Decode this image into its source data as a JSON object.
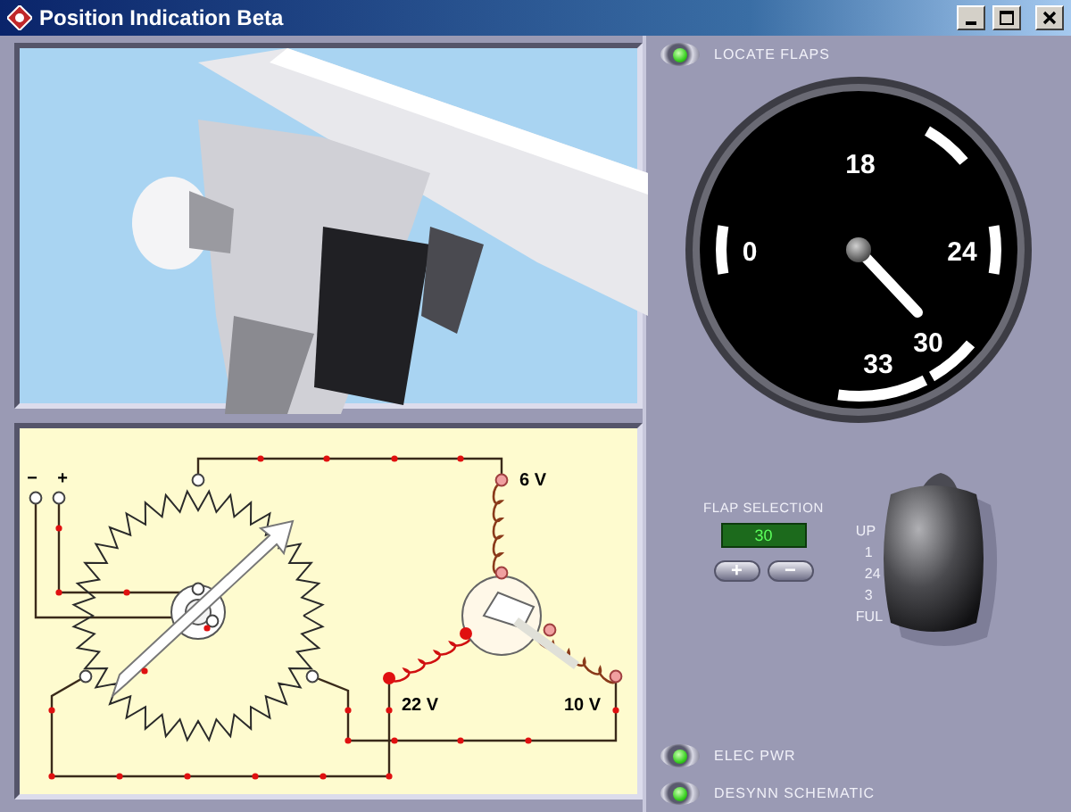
{
  "window": {
    "title": "Position Indication Beta"
  },
  "indicators": [
    {
      "label": "LOCATE FLAPS",
      "on": true
    },
    {
      "label": "ELEC PWR",
      "on": true
    },
    {
      "label": "DESYNN SCHEMATIC",
      "on": true
    }
  ],
  "gauge": {
    "scale_labels": [
      "0",
      "18",
      "24",
      "30",
      "33"
    ]
  },
  "schematic": {
    "terminals": [
      "−",
      "+"
    ],
    "voltages": [
      "6 V",
      "22 V",
      "10 V"
    ]
  },
  "flap_selection": {
    "label": "FLAP SELECTION",
    "value": "30",
    "buttons": [
      "+",
      "−"
    ]
  },
  "flap_lever": {
    "positions": [
      "UP",
      "1",
      "24",
      "3",
      "FUL"
    ]
  }
}
